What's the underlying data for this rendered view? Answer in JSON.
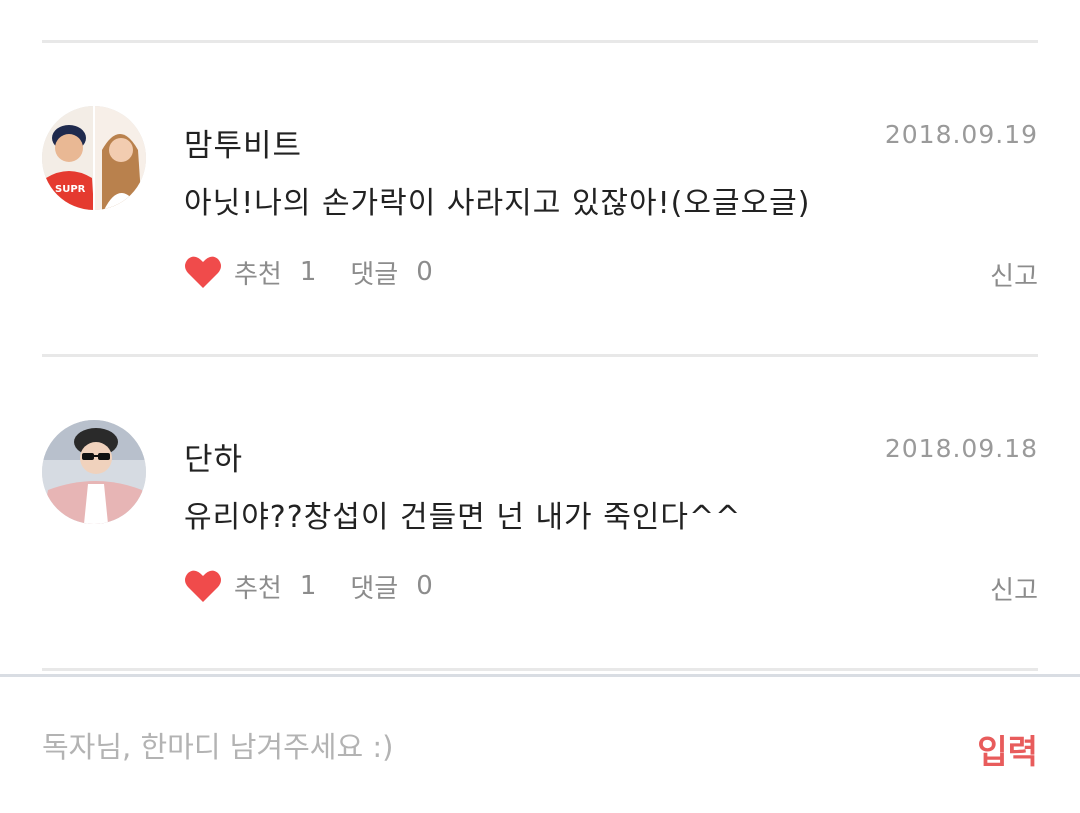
{
  "comments": [
    {
      "author": "맘투비트",
      "date": "2018.09.19",
      "text": "아닛!나의 손가락이 사라지고 있잖아!(오글오글)",
      "like_label": "추천",
      "like_count": "1",
      "reply_label": "댓글",
      "reply_count": "0",
      "report_label": "신고",
      "avatar": "two-person-photo"
    },
    {
      "author": "단하",
      "date": "2018.09.18",
      "text": "유리야??창섭이 건들면 넌 내가 죽인다^^",
      "like_label": "추천",
      "like_count": "1",
      "reply_label": "댓글",
      "reply_count": "0",
      "report_label": "신고",
      "avatar": "person-sunglasses-photo"
    }
  ],
  "input": {
    "placeholder": "독자님, 한마디 남겨주세요 :)",
    "value": "",
    "submit_label": "입력"
  },
  "icons": {
    "like": "heart-icon"
  },
  "colors": {
    "heart": "#f04b4b",
    "submit": "#e85c5c",
    "muted_text": "#8c8c8c",
    "date_text": "#9a9a9a",
    "divider": "#e8e8e8"
  }
}
